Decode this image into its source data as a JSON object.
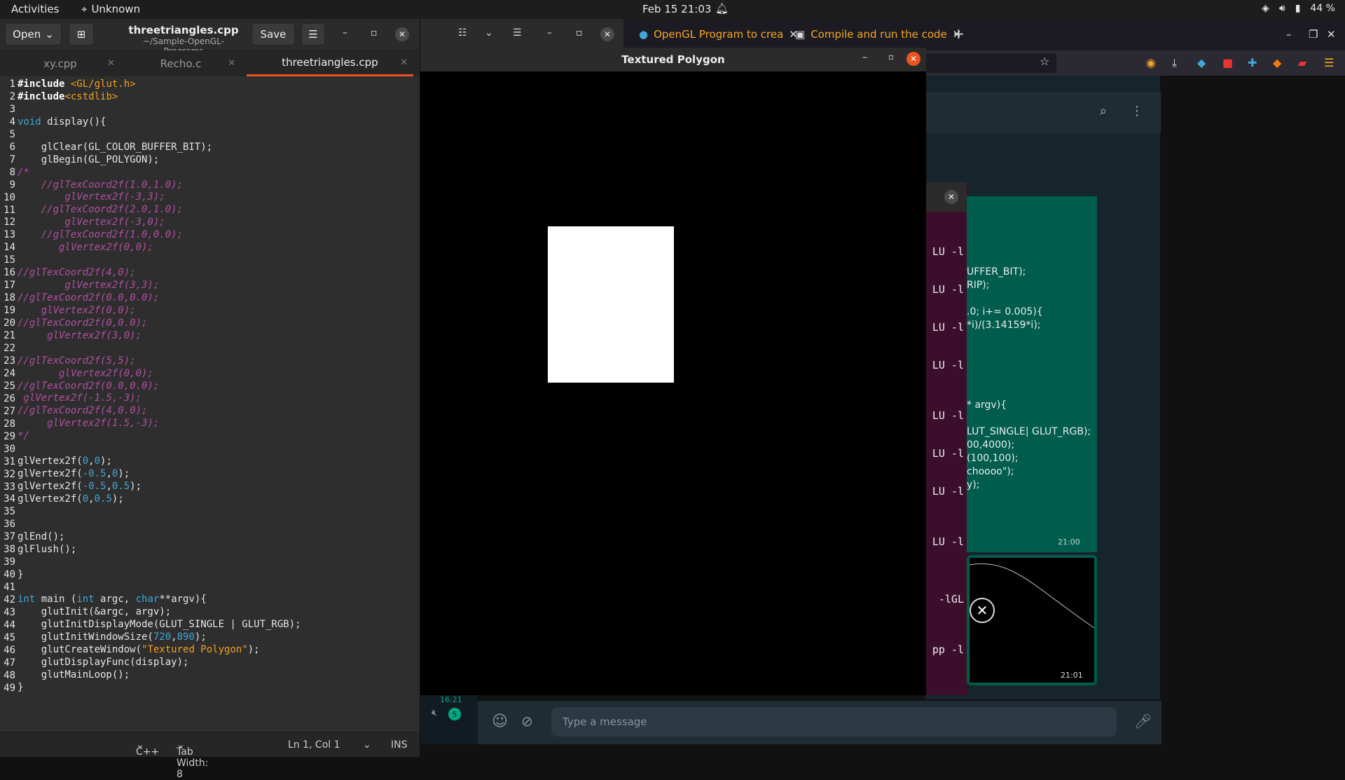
{
  "topbar": {
    "activities": "Activities",
    "app": "Unknown",
    "clock": "Feb 15  21:03",
    "battery": "44 %"
  },
  "gedit": {
    "open_label": "Open",
    "save_label": "Save",
    "title": "threetriangles.cpp",
    "subtitle": "~/Sample-OpenGL-Programs",
    "tabs": [
      {
        "label": "xy.cpp"
      },
      {
        "label": "Recho.c"
      },
      {
        "label": "threetriangles.cpp"
      }
    ],
    "status": {
      "language": "C++",
      "tab_width": "Tab Width: 8",
      "position": "Ln 1, Col 1",
      "mode": "INS"
    }
  },
  "code_lines": [
    "#include <GL/glut.h>",
    "#include<cstdlib>",
    "",
    "void display(){",
    "",
    "    glClear(GL_COLOR_BUFFER_BIT);",
    "    glBegin(GL_POLYGON);",
    "/*",
    "    //glTexCoord2f(1.0,1.0);",
    "        glVertex2f(-3,3);",
    "    //glTexCoord2f(2.0,1.0);",
    "        glVertex2f(-3,0);",
    "    //glTexCoord2f(1.0,0.0);",
    "       glVertex2f(0,0);",
    "",
    "//glTexCoord2f(4,0);",
    "        glVertex2f(3,3);",
    "//glTexCoord2f(0.0,0.0);",
    "    glVertex2f(0,0);",
    "//glTexCoord2f(0,0.0);",
    "     glVertex2f(3,0);",
    "",
    "//glTexCoord2f(5,5);",
    "       glVertex2f(0,0);",
    "//glTexCoord2f(0.0,0.0);",
    " glVertex2f(-1.5,-3);",
    "//glTexCoord2f(4,0.0);",
    "     glVertex2f(1.5,-3);",
    "*/",
    "",
    "glVertex2f(0,0);",
    "glVertex2f(-0.5,0);",
    "glVertex2f(-0.5,0.5);",
    "glVertex2f(0,0.5);",
    "",
    "",
    "glEnd();",
    "glFlush();",
    "",
    "}",
    "",
    "int main (int argc, char**argv){",
    "    glutInit(&argc, argv);",
    "    glutInitDisplayMode(GLUT_SINGLE | GLUT_RGB);",
    "    glutInitWindowSize(720,890);",
    "    glutCreateWindow(\"Textured Polygon\");",
    "    glutDisplayFunc(display);",
    "    glutMainLoop();",
    "}"
  ],
  "glwindow": {
    "title": "Textured Polygon"
  },
  "firefox": {
    "tabs": [
      {
        "label": "OpenGL Program to crea"
      },
      {
        "label": "Compile and run the code"
      }
    ]
  },
  "terminal_lines": [
    "LU -l",
    "LU -l",
    "LU -l",
    "LU -l",
    "LU -l",
    "LU -l",
    "LU -l",
    "LU -l",
    "-lGL",
    "pp -l"
  ],
  "chat": {
    "bubble_lines": [
      "UFFER_BIT);",
      "RIP);",
      "",
      ".0; i+= 0.005){",
      "*i)/(3.14159*i);",
      "",
      "",
      "",
      "",
      "",
      "* argv){",
      "",
      "LUT_SINGLE| GLUT_RGB);",
      "00,4000);",
      "(100,100);",
      "choooo\");",
      "y);"
    ],
    "time1": "21:00",
    "time2": "21:01",
    "sidebar_time": "16:21",
    "unread": "5",
    "placeholder": "Type a message"
  }
}
